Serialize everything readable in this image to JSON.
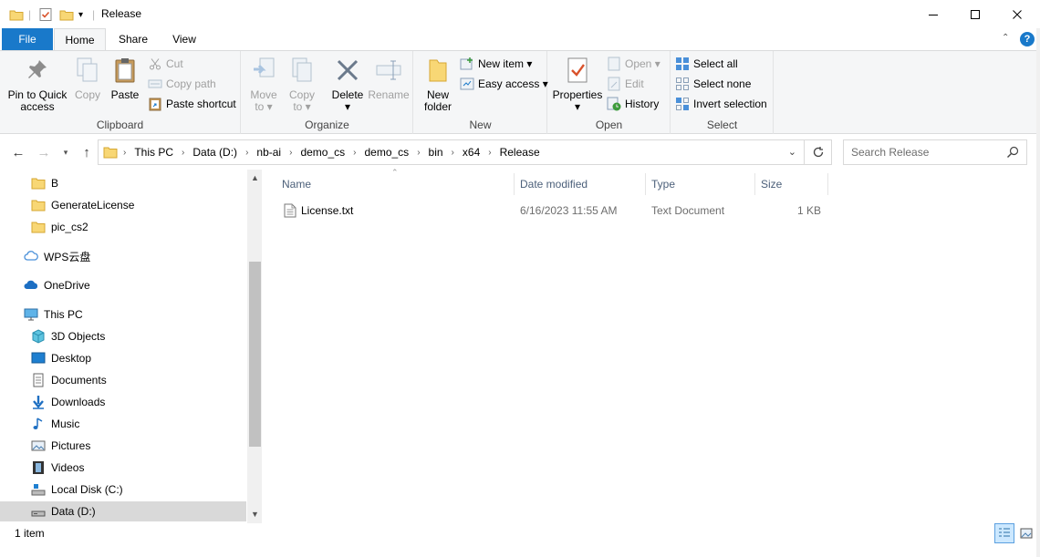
{
  "window": {
    "title": "Release"
  },
  "tabs": {
    "file": "File",
    "home": "Home",
    "share": "Share",
    "view": "View"
  },
  "ribbon": {
    "clipboard": {
      "label": "Clipboard",
      "pin": [
        "Pin to Quick",
        "access"
      ],
      "copy": "Copy",
      "paste": "Paste",
      "cut": "Cut",
      "copy_path": "Copy path",
      "paste_shortcut": "Paste shortcut"
    },
    "organize": {
      "label": "Organize",
      "move_to": [
        "Move",
        "to ▾"
      ],
      "copy_to": [
        "Copy",
        "to ▾"
      ],
      "delete": [
        "Delete",
        "▾"
      ],
      "rename": "Rename"
    },
    "new": {
      "label": "New",
      "new_folder": [
        "New",
        "folder"
      ],
      "new_item": "New item ▾",
      "easy_access": "Easy access ▾"
    },
    "open": {
      "label": "Open",
      "properties": [
        "Properties",
        "▾"
      ],
      "open": "Open ▾",
      "edit": "Edit",
      "history": "History"
    },
    "select": {
      "label": "Select",
      "select_all": "Select all",
      "select_none": "Select none",
      "invert": "Invert selection"
    }
  },
  "address": {
    "crumbs": [
      "This PC",
      "Data (D:)",
      "nb-ai",
      "demo_cs",
      "demo_cs",
      "bin",
      "x64",
      "Release"
    ],
    "search_placeholder": "Search Release"
  },
  "nav": {
    "folders": [
      "B",
      "GenerateLicense",
      "pic_cs2"
    ],
    "wps": "WPS云盘",
    "onedrive": "OneDrive",
    "this_pc": "This PC",
    "pc_items": [
      "3D Objects",
      "Desktop",
      "Documents",
      "Downloads",
      "Music",
      "Pictures",
      "Videos",
      "Local Disk (C:)",
      "Data (D:)"
    ]
  },
  "columns": {
    "name": "Name",
    "date": "Date modified",
    "type": "Type",
    "size": "Size"
  },
  "files": [
    {
      "name": "License.txt",
      "date": "6/16/2023 11:55 AM",
      "type": "Text Document",
      "size": "1 KB"
    }
  ],
  "status": {
    "count": "1 item"
  },
  "colors": {
    "accent": "#1979ca",
    "folder": "#f8d775",
    "selected": "#d9d9d9"
  }
}
